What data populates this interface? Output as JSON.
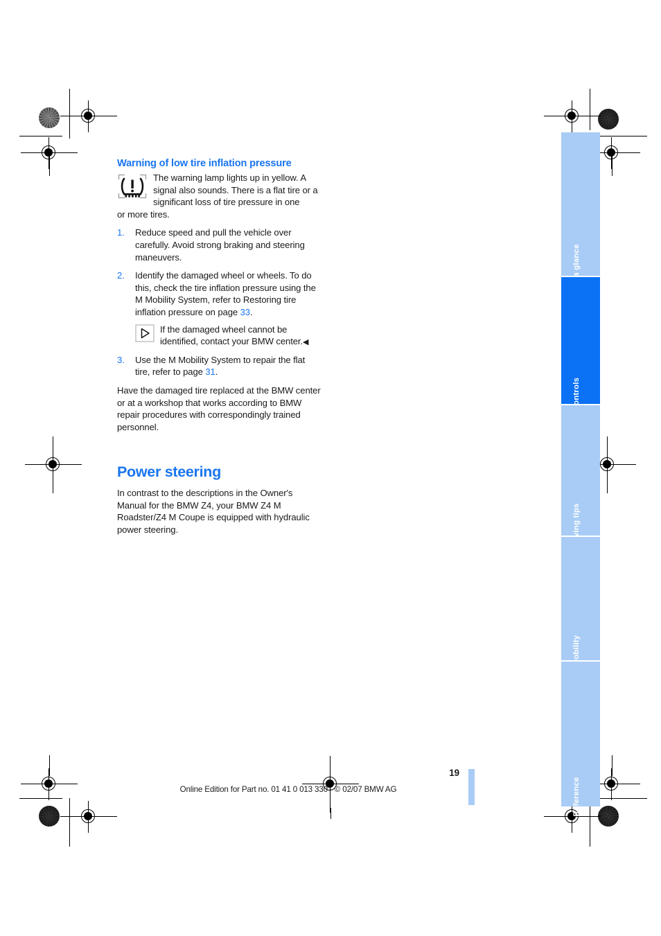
{
  "document": {
    "page_number": "19",
    "footer_note": "Online Edition for Part no. 01 41 0 013 330 - © 02/07 BMW AG"
  },
  "colors": {
    "heading_blue": "#1a75ee",
    "tab_inactive": "#a8ccf5",
    "tab_active": "#0b71f5",
    "body_text": "#1a1a1a"
  },
  "sections": {
    "warning": {
      "heading": "Warning of low tire inflation pressure",
      "icon": "tpms-warning-icon",
      "intro_indented": "The warning lamp lights up in yellow. A signal also sounds. There is a flat tire or a significant loss of tire pressure in one",
      "intro_continuation": "or more tires.",
      "steps": [
        {
          "number": "1.",
          "text": "Reduce speed and pull the vehicle over carefully. Avoid strong braking and steering maneuvers."
        },
        {
          "number": "2.",
          "text_before_ref": "Identify the damaged wheel or wheels. To do this, check the tire inflation pressure using the M Mobility System, refer to Restoring tire inflation pressure on page ",
          "page_ref": "33",
          "text_after_ref": "."
        },
        {
          "number": "3.",
          "text_before_ref": "Use the M Mobility System to repair the flat tire, refer to page ",
          "page_ref": "31",
          "text_after_ref": "."
        }
      ],
      "note": {
        "icon": "triangle-note-icon",
        "text": "If the damaged wheel cannot be identified, contact your BMW center.",
        "end_mark": "◀"
      },
      "closing_paragraph": "Have the damaged tire replaced at the BMW center or at a workshop that works according to BMW repair procedures with correspondingly trained personnel."
    },
    "power_steering": {
      "heading": "Power steering",
      "body": "In contrast to the descriptions in the Owner's Manual for the BMW Z4, your BMW Z4 M Roadster/Z4 M Coupe is equipped with hydraulic power steering."
    }
  },
  "side_tabs": [
    {
      "label": "At a glance",
      "active": false
    },
    {
      "label": "Controls",
      "active": true
    },
    {
      "label": "Driving tips",
      "active": false
    },
    {
      "label": "Mobility",
      "active": false
    },
    {
      "label": "Reference",
      "active": false
    }
  ]
}
